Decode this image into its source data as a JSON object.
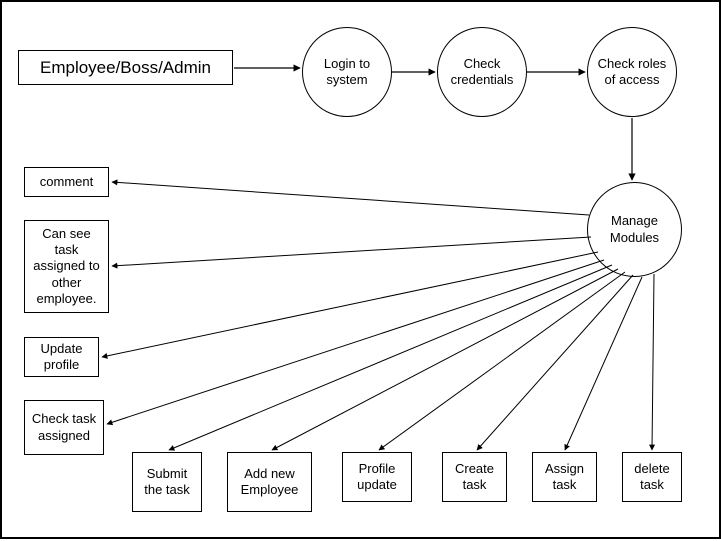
{
  "actor": "Employee/Boss/Admin",
  "steps": {
    "login": "Login to system",
    "check_credentials": "Check credentials",
    "check_roles": "Check roles of access",
    "manage_modules": "Manage Modules"
  },
  "modules": {
    "comment": "comment",
    "see_task_other": "Can see task assigned to other employee.",
    "update_profile": "Update profile",
    "check_task_assigned": "Check task assigned",
    "submit_task": "Submit the task",
    "add_employee": "Add new Employee",
    "profile_update": "Profile update",
    "create_task": "Create task",
    "assign_task": "Assign task",
    "delete_task": "delete task"
  },
  "chart_data": {
    "type": "flow-diagram",
    "nodes": [
      {
        "id": "actor",
        "label": "Employee/Boss/Admin",
        "shape": "rect"
      },
      {
        "id": "login",
        "label": "Login to system",
        "shape": "circle"
      },
      {
        "id": "check_credentials",
        "label": "Check credentials",
        "shape": "circle"
      },
      {
        "id": "check_roles",
        "label": "Check roles of access",
        "shape": "circle"
      },
      {
        "id": "manage_modules",
        "label": "Manage Modules",
        "shape": "circle"
      },
      {
        "id": "comment",
        "label": "comment",
        "shape": "rect"
      },
      {
        "id": "see_task_other",
        "label": "Can see task assigned to other employee.",
        "shape": "rect"
      },
      {
        "id": "update_profile",
        "label": "Update profile",
        "shape": "rect"
      },
      {
        "id": "check_task_assigned",
        "label": "Check task assigned",
        "shape": "rect"
      },
      {
        "id": "submit_task",
        "label": "Submit the task",
        "shape": "rect"
      },
      {
        "id": "add_employee",
        "label": "Add new Employee",
        "shape": "rect"
      },
      {
        "id": "profile_update",
        "label": "Profile update",
        "shape": "rect"
      },
      {
        "id": "create_task",
        "label": "Create task",
        "shape": "rect"
      },
      {
        "id": "assign_task",
        "label": "Assign task",
        "shape": "rect"
      },
      {
        "id": "delete_task",
        "label": "delete task",
        "shape": "rect"
      }
    ],
    "edges": [
      {
        "from": "actor",
        "to": "login"
      },
      {
        "from": "login",
        "to": "check_credentials"
      },
      {
        "from": "check_credentials",
        "to": "check_roles"
      },
      {
        "from": "check_roles",
        "to": "manage_modules"
      },
      {
        "from": "manage_modules",
        "to": "comment"
      },
      {
        "from": "manage_modules",
        "to": "see_task_other"
      },
      {
        "from": "manage_modules",
        "to": "update_profile"
      },
      {
        "from": "manage_modules",
        "to": "check_task_assigned"
      },
      {
        "from": "manage_modules",
        "to": "submit_task"
      },
      {
        "from": "manage_modules",
        "to": "add_employee"
      },
      {
        "from": "manage_modules",
        "to": "profile_update"
      },
      {
        "from": "manage_modules",
        "to": "create_task"
      },
      {
        "from": "manage_modules",
        "to": "assign_task"
      },
      {
        "from": "manage_modules",
        "to": "delete_task"
      }
    ]
  }
}
